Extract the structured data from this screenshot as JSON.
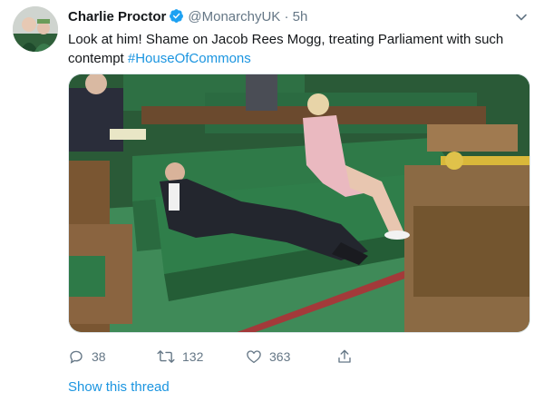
{
  "tweet": {
    "author_name": "Charlie Proctor",
    "handle": "@MonarchyUK",
    "separator": "·",
    "time": "5h",
    "text": "Look at him! Shame on Jacob Rees Mogg, treating Parliament with such contempt ",
    "hashtag": "#HouseOfCommons",
    "replies": "38",
    "retweets": "132",
    "likes": "363",
    "thread_link": "Show this thread"
  },
  "colors": {
    "link": "#1b95e0",
    "muted": "#657786",
    "bench_green": "#2e7a48",
    "carpet_green": "#3d8a55"
  },
  "icons": [
    "verified-badge-icon",
    "chevron-down-icon",
    "reply-icon",
    "retweet-icon",
    "like-icon",
    "share-icon"
  ]
}
